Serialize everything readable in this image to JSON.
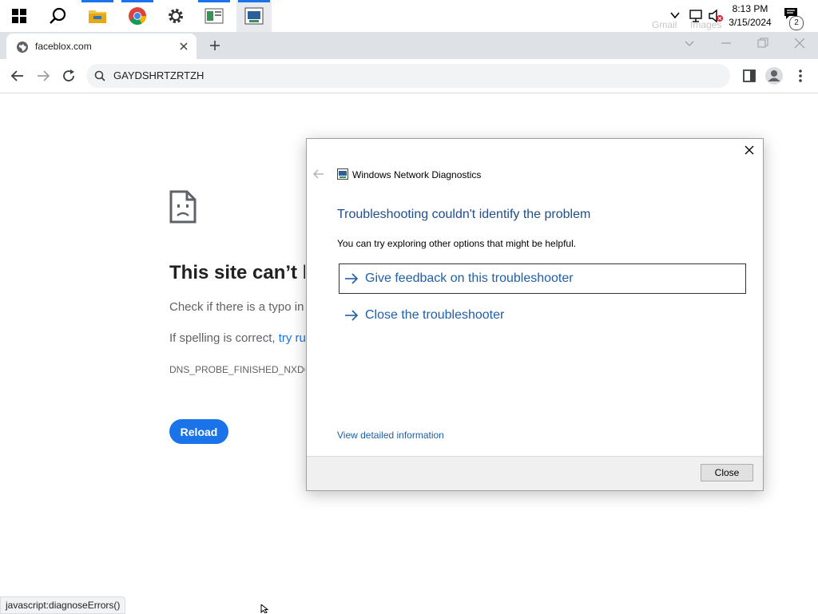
{
  "taskbar": {
    "apps": [
      {
        "name": "start-icon"
      },
      {
        "name": "search-icon"
      },
      {
        "name": "file-explorer-icon"
      },
      {
        "name": "chrome-icon"
      },
      {
        "name": "settings-icon"
      },
      {
        "name": "app-window-icon"
      },
      {
        "name": "network-diagnostics-icon"
      }
    ],
    "time": "8:13 PM",
    "date": "3/15/2024",
    "notification_count": "2",
    "ghost_text_gmail": "Gmail",
    "ghost_text_images": "Images"
  },
  "browser": {
    "tab_title": "faceblox.com",
    "omnibox_text": "GAYDSHRTZRTZH",
    "status_text": "javascript:diagnoseErrors()"
  },
  "error_page": {
    "title": "This site can’t be reached",
    "line1": "Check if there is a typo in faceblox.com.",
    "line2_prefix": "If spelling is correct, ",
    "line2_link": "try running Windows Network Diagnostics",
    "error_code": "DNS_PROBE_FINISHED_NXDOMAIN",
    "reload_label": "Reload"
  },
  "dialog": {
    "window_title": "Windows Network Diagnostics",
    "heading": "Troubleshooting couldn't identify the problem",
    "description": "You can try exploring other options that might be helpful.",
    "options": [
      {
        "label": "Give feedback on this troubleshooter"
      },
      {
        "label": "Close the troubleshooter"
      }
    ],
    "details_link": "View detailed information",
    "close_button": "Close"
  },
  "colors": {
    "accent": "#1a73e8",
    "dialog_heading": "#1f4e8c",
    "link": "#1f5fa8"
  }
}
